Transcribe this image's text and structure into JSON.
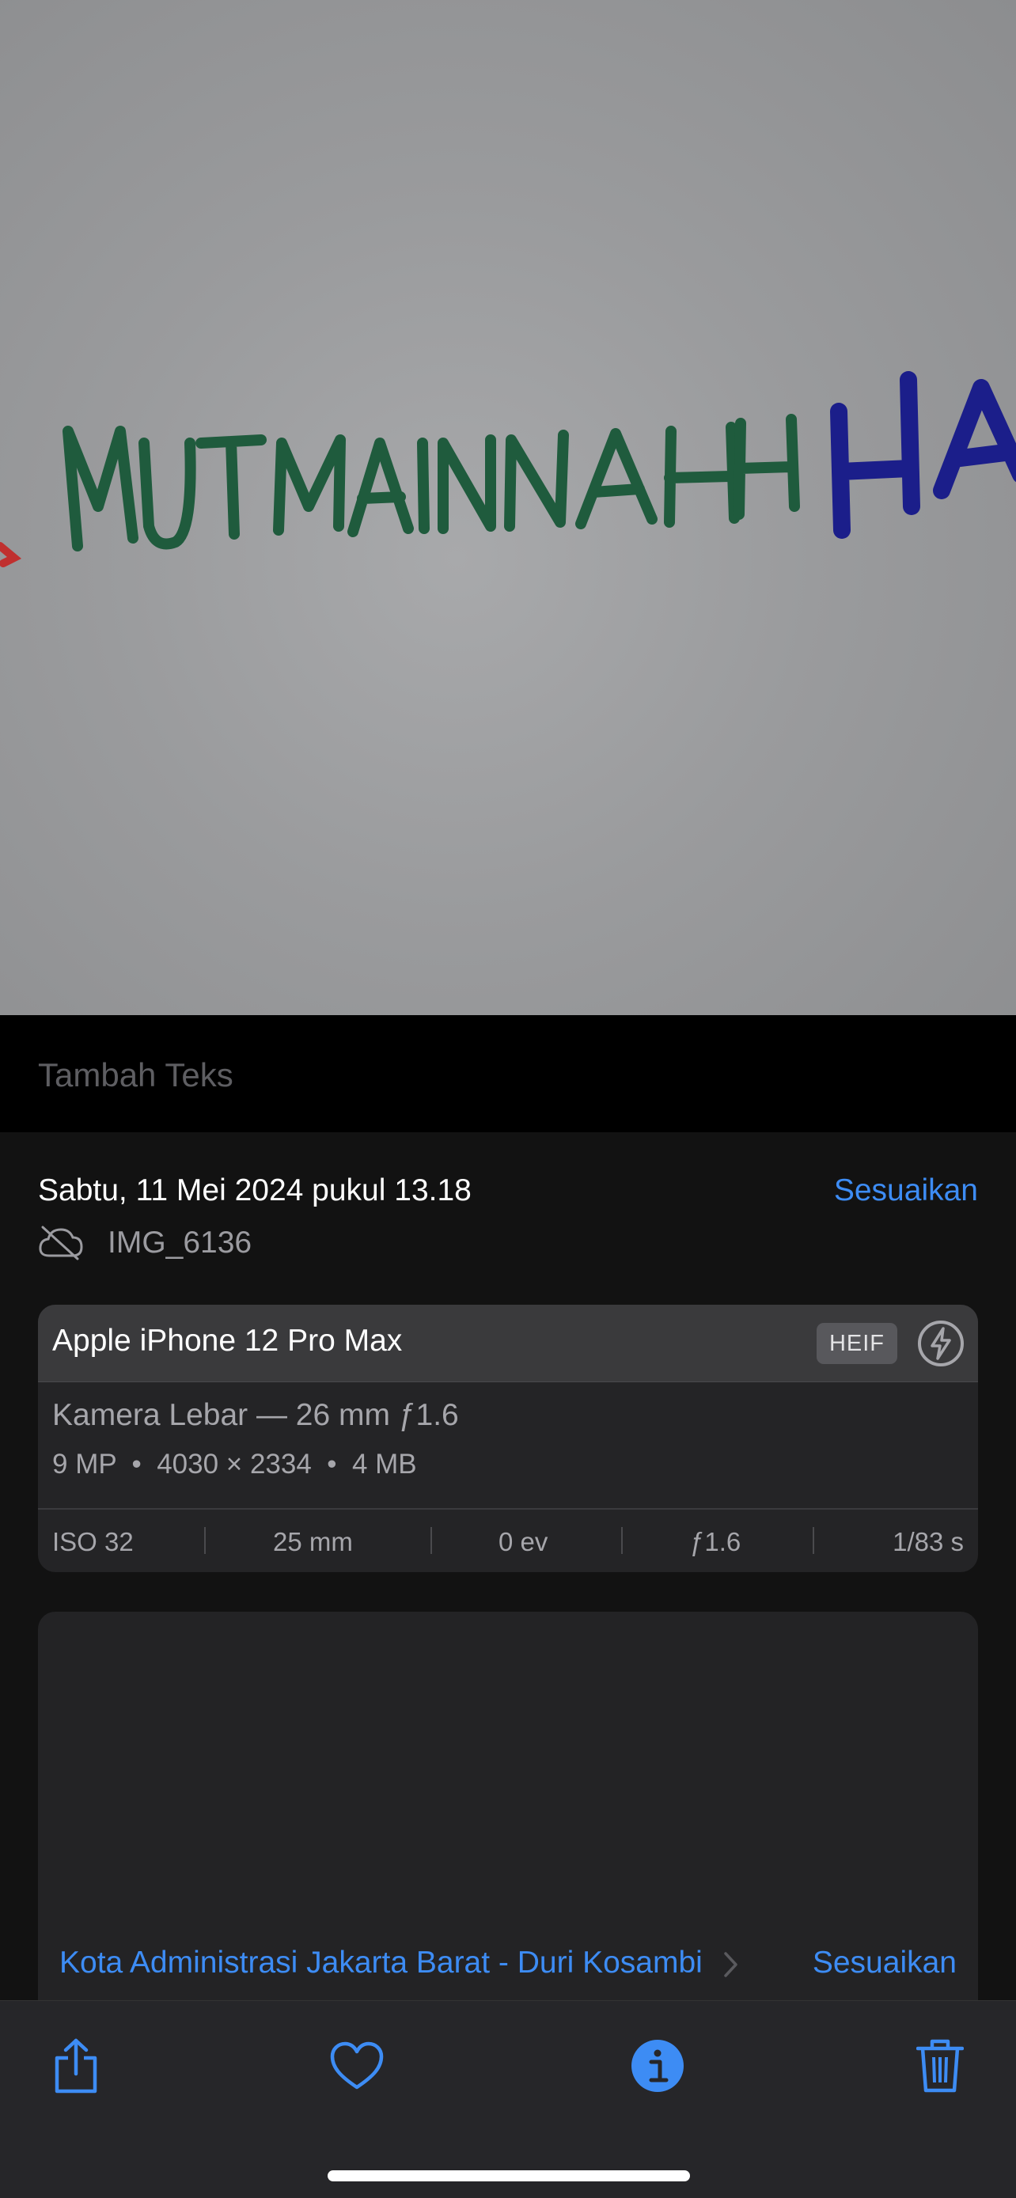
{
  "photo": {
    "handwriting_green": "MUTMAINNAH",
    "handwriting_blue": "HA",
    "colors": {
      "green_marker": "#1f5b3d",
      "blue_marker": "#1b1e8a",
      "red_marker": "#c0302f"
    }
  },
  "caption": {
    "placeholder": "Tambah Teks"
  },
  "info": {
    "date": "Sabtu, 11 Mei 2024 pukul 13.18",
    "adjust_label": "Sesuaikan",
    "filename": "IMG_6136",
    "file_icon": "cloud-slash-icon"
  },
  "device_card": {
    "device": "Apple iPhone 12 Pro Max",
    "format_badge": "HEIF",
    "flash_icon": "flash-off-icon",
    "lens": "Kamera Lebar — 26 mm ƒ1.6",
    "specs": "9 MP  •  4030 × 2334  •  4 MB",
    "exif": {
      "iso": "ISO 32",
      "focal": "25 mm",
      "ev": "0 ev",
      "aperture": "ƒ1.6",
      "shutter": "1/83 s"
    }
  },
  "map_card": {
    "location": "Kota Administrasi Jakarta Barat - Duri Kosambi",
    "adjust_label": "Sesuaikan"
  },
  "toolbar": {
    "share_icon": "share-icon",
    "favorite_icon": "heart-icon",
    "info_icon": "info-icon",
    "delete_icon": "trash-icon"
  },
  "accent_color": "#3d8cf4"
}
